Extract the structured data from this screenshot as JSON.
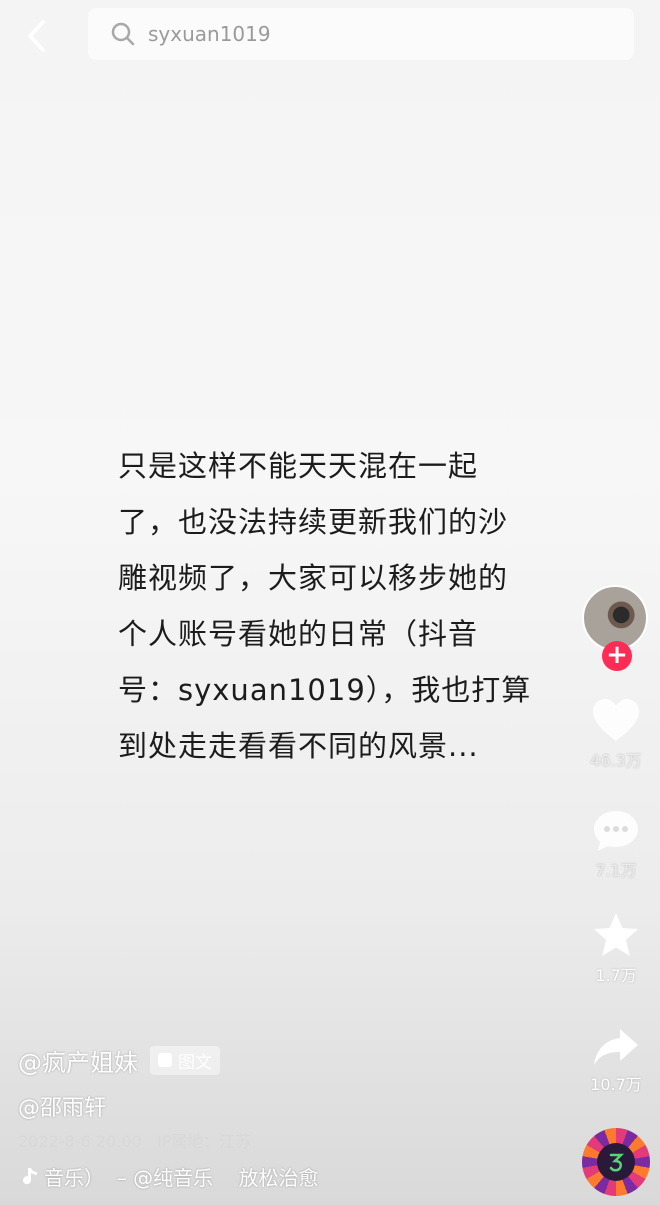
{
  "search": {
    "query": "syxuan1019"
  },
  "post": {
    "lines": [
      "只是这样不能天天混在一起",
      "了，也没法持续更新我们的沙",
      "雕视频了，大家可以移步她的",
      "个人账号看她的日常（抖音",
      "号：syxuan1019），我也打算",
      "到处走走看看不同的风景..."
    ]
  },
  "actions": {
    "likes": "46.3万",
    "comments": "7.1万",
    "favorites": "1.7万",
    "shares": "10.7万",
    "follow_symbol": "+"
  },
  "meta": {
    "author": "@疯产姐妹",
    "badge": "图文",
    "mention": "@邵雨轩",
    "date": "2022-8-6 20:00",
    "ip": "IP属地：江苏",
    "music": "音乐）  – @纯音乐    放松治愈"
  },
  "colors": {
    "follow": "#fe2c55"
  }
}
